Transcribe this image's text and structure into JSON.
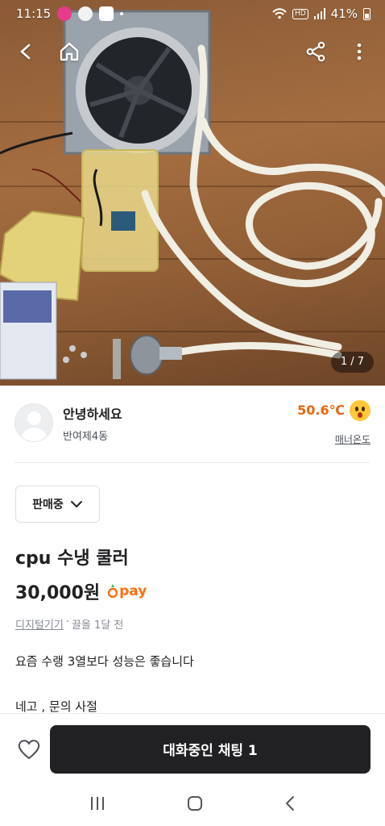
{
  "status_bar": {
    "time": "11:15",
    "battery": "41%",
    "network_badge": "HD"
  },
  "top_nav": {
    "back": "back-icon",
    "home": "home-icon",
    "share": "share-icon",
    "more": "more-vertical-icon"
  },
  "photo": {
    "pager": "1 / 7",
    "current_index": 1,
    "total": 7
  },
  "seller": {
    "name": "안녕하세요",
    "location": "반여제4동",
    "temperature": "50.6℃",
    "manner_label": "매너온도"
  },
  "listing": {
    "status": "판매중",
    "title": "cpu 수냉 쿨러",
    "price": "30,000원",
    "pay_label": "pay",
    "category": "디지털기기",
    "separator": "·",
    "bump_time": "끌올 1달 전",
    "description": [
      "요즘 수랭 3열보다 성능은 좋습니다",
      "네고 , 문의 사절"
    ]
  },
  "action_bar": {
    "chat_button": "대화중인 채팅 1"
  },
  "colors": {
    "accent_orange": "#ff6f0f",
    "temperature": "#e8660c",
    "chat_button_bg": "#212124"
  }
}
